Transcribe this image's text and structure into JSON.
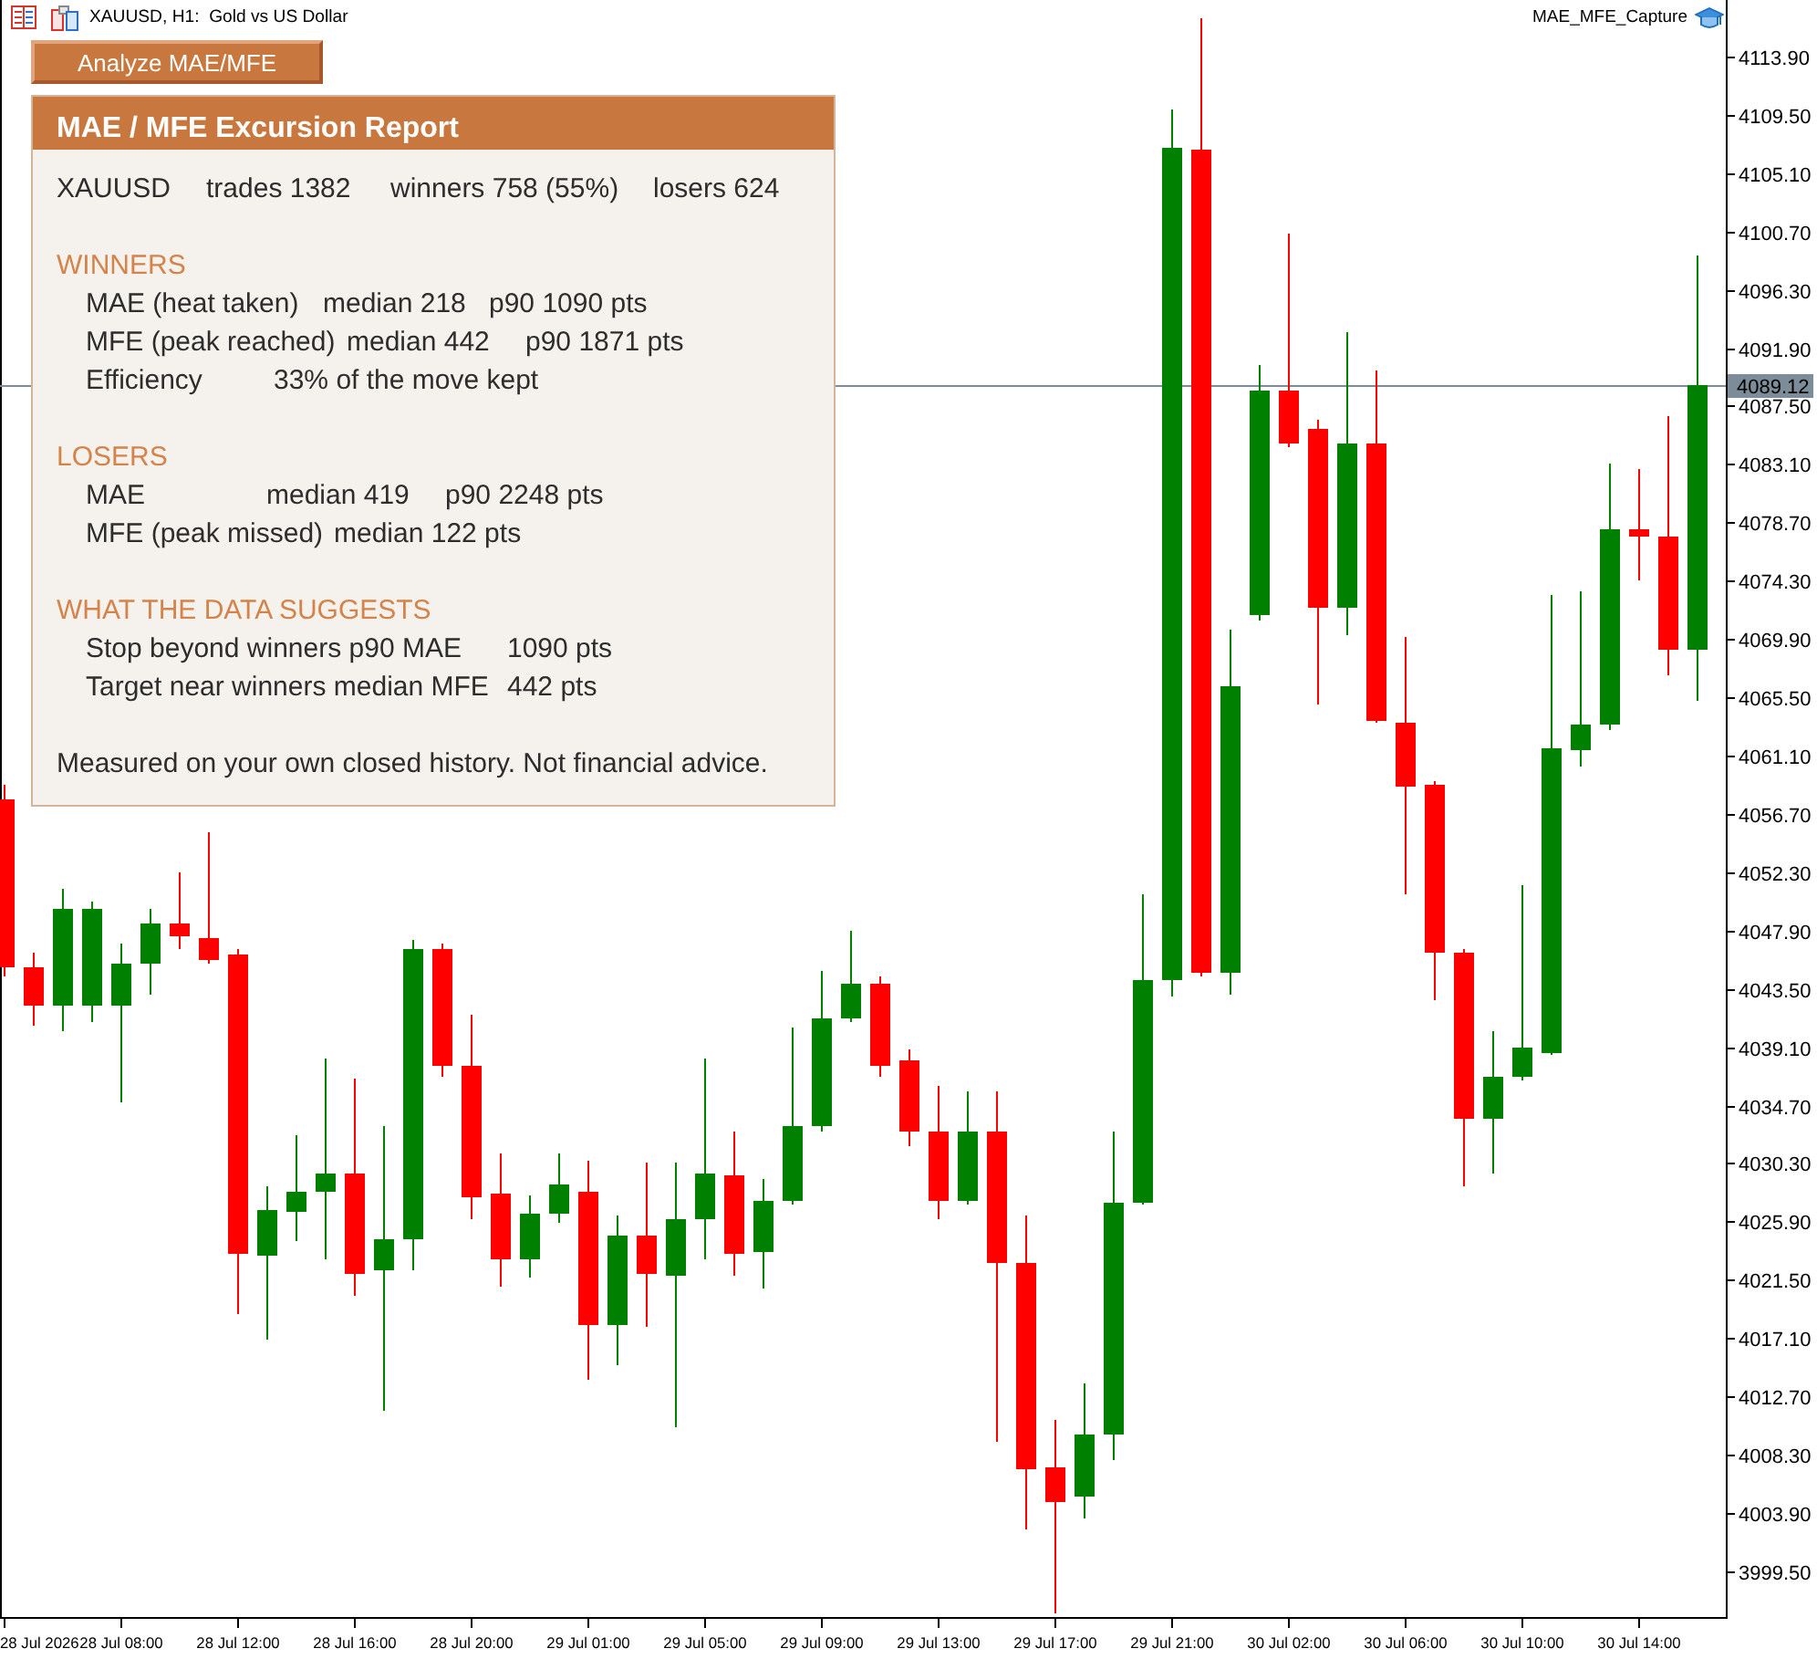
{
  "chart_header": {
    "symbol_line": "XAUUSD, H1:  Gold vs US Dollar",
    "indicator": "MAE_MFE_Capture"
  },
  "analyze_button": {
    "label": "Analyze MAE/MFE"
  },
  "report": {
    "title": "MAE / MFE Excursion Report",
    "summary": [
      "XAUUSD",
      "trades 1382",
      "winners 758 (55%)",
      "losers 624"
    ],
    "sections": [
      {
        "heading": "WINNERS",
        "rows": [
          {
            "label": "MAE (heat taken)",
            "values": [
              "median 218",
              "p90 1090 pts"
            ]
          },
          {
            "label": "MFE (peak reached)",
            "values": [
              "median 442",
              "p90 1871 pts"
            ]
          },
          {
            "label": "Efficiency",
            "values": [
              "33% of the move kept"
            ]
          }
        ]
      },
      {
        "heading": "LOSERS",
        "rows": [
          {
            "label": "MAE",
            "values": [
              "median 419",
              "p90 2248 pts"
            ]
          },
          {
            "label": "MFE (peak missed)",
            "values": [
              "median 122 pts"
            ]
          }
        ]
      },
      {
        "heading": "WHAT THE DATA SUGGESTS",
        "rows": [
          {
            "label": "Stop beyond winners p90 MAE",
            "values": [
              "1090 pts"
            ]
          },
          {
            "label": "Target near winners median MFE",
            "values": [
              "442 pts"
            ]
          }
        ]
      }
    ],
    "footer": "Measured on your own closed history. Not financial advice."
  },
  "chart": {
    "start_date": "28 Jul 2026",
    "chart_data": {
      "type": "candlestick",
      "categories": [
        null,
        null,
        null,
        null,
        "28 Jul 08:00",
        null,
        null,
        null,
        "28 Jul 12:00",
        null,
        null,
        null,
        "28 Jul 16:00",
        null,
        null,
        null,
        "28 Jul 20:00",
        null,
        null,
        null,
        "29 Jul 01:00",
        null,
        null,
        null,
        "29 Jul 05:00",
        null,
        null,
        null,
        "29 Jul 09:00",
        null,
        null,
        null,
        "29 Jul 13:00",
        null,
        null,
        null,
        "29 Jul 17:00",
        null,
        null,
        null,
        "29 Jul 21:00",
        null,
        null,
        null,
        "30 Jul 02:00",
        null,
        null,
        null,
        "30 Jul 06:00",
        null,
        null,
        null,
        "30 Jul 10:00",
        null,
        null,
        null,
        "30 Jul 14:00",
        null,
        null
      ],
      "ylim": [
        3996.04,
        4118.17
      ],
      "yticks": [
        {
          "value": 4113.9,
          "label": "4113.90"
        },
        {
          "value": 4109.5,
          "label": "4109.50"
        },
        {
          "value": 4105.1,
          "label": "4105.10"
        },
        {
          "value": 4100.7,
          "label": "4100.70"
        },
        {
          "value": 4096.3,
          "label": "4096.30"
        },
        {
          "value": 4091.9,
          "label": "4091.90"
        },
        {
          "value": 4087.5,
          "label": "4087.50"
        },
        {
          "value": 4083.1,
          "label": "4083.10"
        },
        {
          "value": 4078.7,
          "label": "4078.70"
        },
        {
          "value": 4074.3,
          "label": "4074.30"
        },
        {
          "value": 4069.9,
          "label": "4069.90"
        },
        {
          "value": 4065.5,
          "label": "4065.50"
        },
        {
          "value": 4061.1,
          "label": "4061.10"
        },
        {
          "value": 4056.7,
          "label": "4056.70"
        },
        {
          "value": 4052.3,
          "label": "4052.30"
        },
        {
          "value": 4047.9,
          "label": "4047.90"
        },
        {
          "value": 4043.5,
          "label": "4043.50"
        },
        {
          "value": 4039.1,
          "label": "4039.10"
        },
        {
          "value": 4034.7,
          "label": "4034.70"
        },
        {
          "value": 4030.3,
          "label": "4030.30"
        },
        {
          "value": 4025.9,
          "label": "4025.90"
        },
        {
          "value": 4021.5,
          "label": "4021.50"
        },
        {
          "value": 4017.1,
          "label": "4017.10"
        },
        {
          "value": 4012.7,
          "label": "4012.70"
        },
        {
          "value": 4008.3,
          "label": "4008.30"
        },
        {
          "value": 4003.9,
          "label": "4003.90"
        },
        {
          "value": 3999.5,
          "label": "3999.50"
        }
      ],
      "ohlc": [
        [
          4057.8,
          4058.9,
          4044.4,
          4045.1
        ],
        [
          4045.1,
          4046.2,
          4040.7,
          4042.2
        ],
        [
          4042.2,
          4051.0,
          4040.3,
          4049.5
        ],
        [
          4042.2,
          4050.1,
          4041.0,
          4049.5
        ],
        [
          4042.2,
          4046.9,
          4034.9,
          4045.4
        ],
        [
          4045.4,
          4049.5,
          4043.0,
          4048.4
        ],
        [
          4048.4,
          4052.3,
          4046.5,
          4047.5
        ],
        [
          4047.3,
          4055.3,
          4045.4,
          4045.7
        ],
        [
          4046.1,
          4046.5,
          4018.9,
          4023.5
        ],
        [
          4023.3,
          4028.6,
          4017.0,
          4026.8
        ],
        [
          4026.6,
          4032.4,
          4024.4,
          4028.2
        ],
        [
          4028.2,
          4038.2,
          4023.1,
          4029.5
        ],
        [
          4029.5,
          4036.7,
          4020.3,
          4022.0
        ],
        [
          4022.2,
          4033.1,
          4011.6,
          4024.6
        ],
        [
          4024.6,
          4047.2,
          4022.2,
          4046.5
        ],
        [
          4046.5,
          4046.9,
          4036.8,
          4037.7
        ],
        [
          4037.7,
          4041.5,
          4026.1,
          4027.7
        ],
        [
          4028.0,
          4031.1,
          4021.0,
          4023.1
        ],
        [
          4023.1,
          4027.9,
          4021.7,
          4026.5
        ],
        [
          4026.5,
          4031.1,
          4025.8,
          4028.7
        ],
        [
          4028.2,
          4030.5,
          4014.0,
          4018.1
        ],
        [
          4018.1,
          4026.4,
          4015.1,
          4024.8
        ],
        [
          4024.8,
          4030.4,
          4018.0,
          4022.0
        ],
        [
          4021.8,
          4030.4,
          4010.4,
          4026.1
        ],
        [
          4026.1,
          4038.2,
          4023.1,
          4029.5
        ],
        [
          4029.4,
          4032.7,
          4021.8,
          4023.5
        ],
        [
          4023.6,
          4029.1,
          4020.9,
          4027.5
        ],
        [
          4027.5,
          4040.6,
          4027.2,
          4033.1
        ],
        [
          4033.1,
          4044.8,
          4032.7,
          4041.3
        ],
        [
          4041.3,
          4047.9,
          4041.0,
          4043.9
        ],
        [
          4043.9,
          4044.4,
          4036.8,
          4037.7
        ],
        [
          4038.1,
          4038.9,
          4031.6,
          4032.7
        ],
        [
          4032.7,
          4036.2,
          4026.1,
          4027.5
        ],
        [
          4027.5,
          4035.7,
          4027.2,
          4032.7
        ],
        [
          4032.7,
          4035.7,
          4009.3,
          4022.8
        ],
        [
          4022.8,
          4026.4,
          4002.7,
          4007.2
        ],
        [
          4007.3,
          4010.9,
          3996.3,
          4004.7
        ],
        [
          4005.1,
          4013.7,
          4003.5,
          4009.8
        ],
        [
          4009.8,
          4032.7,
          4007.9,
          4027.3
        ],
        [
          4027.3,
          4050.6,
          4027.2,
          4044.1
        ],
        [
          4044.1,
          4109.9,
          4042.9,
          4107.0
        ],
        [
          4106.9,
          4116.8,
          4044.4,
          4044.7
        ],
        [
          4044.7,
          4070.6,
          4043.0,
          4066.3
        ],
        [
          4071.7,
          4090.6,
          4071.3,
          4088.7
        ],
        [
          4088.7,
          4100.5,
          4084.4,
          4084.7
        ],
        [
          4085.8,
          4086.5,
          4065.0,
          4072.3
        ],
        [
          4072.3,
          4093.1,
          4070.2,
          4084.7
        ],
        [
          4084.7,
          4090.2,
          4063.6,
          4063.7
        ],
        [
          4063.6,
          4070.1,
          4050.6,
          4058.8
        ],
        [
          4058.9,
          4059.2,
          4042.6,
          4046.2
        ],
        [
          4046.2,
          4046.5,
          4028.6,
          4033.7
        ],
        [
          4033.7,
          4040.3,
          4029.5,
          4036.8
        ],
        [
          4036.8,
          4051.3,
          4036.6,
          4039.0
        ],
        [
          4038.6,
          4073.2,
          4038.5,
          4061.7
        ],
        [
          4061.5,
          4073.5,
          4060.3,
          4063.4
        ],
        [
          4063.4,
          4083.2,
          4063.0,
          4078.2
        ],
        [
          4078.2,
          4082.7,
          4074.3,
          4077.6
        ],
        [
          4077.6,
          4086.7,
          4067.2,
          4069.1
        ],
        [
          4069.1,
          4098.9,
          4065.2,
          4089.1
        ]
      ],
      "ref_lines": [
        {
          "axis": "y",
          "value": 4089.12,
          "label": "4089.12"
        }
      ]
    }
  }
}
